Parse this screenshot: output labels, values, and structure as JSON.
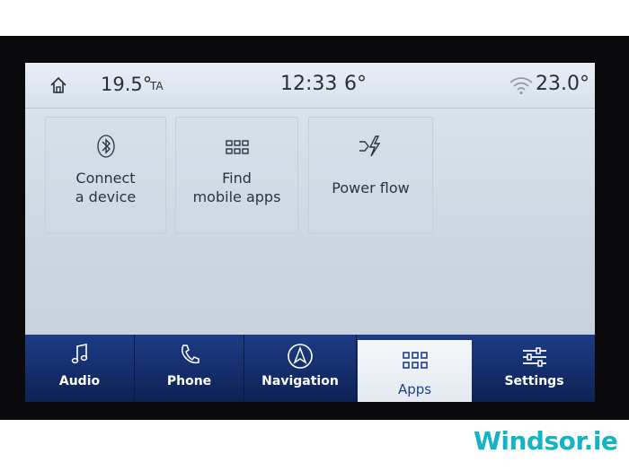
{
  "status_bar": {
    "outside_temp": "19.5°",
    "ta_label": "TA",
    "time": "12:33",
    "gear_indicator": "6°",
    "inside_temp": "23.0°"
  },
  "tiles": [
    {
      "label_line1": "Connect",
      "label_line2": "a device",
      "icon": "bluetooth-icon"
    },
    {
      "label_line1": "Find",
      "label_line2": "mobile apps",
      "icon": "grid-icon"
    },
    {
      "label_line1": "Power flow",
      "icon": "power-flow-icon"
    }
  ],
  "nav": {
    "audio": "Audio",
    "phone": "Phone",
    "navigation": "Navigation",
    "apps": "Apps",
    "settings": "Settings"
  },
  "branding": {
    "watermark": "Windsor.ie"
  },
  "colors": {
    "nav_background": "#142c68",
    "active_tab": "#f4f7fa",
    "brand": "#14b4c7"
  }
}
